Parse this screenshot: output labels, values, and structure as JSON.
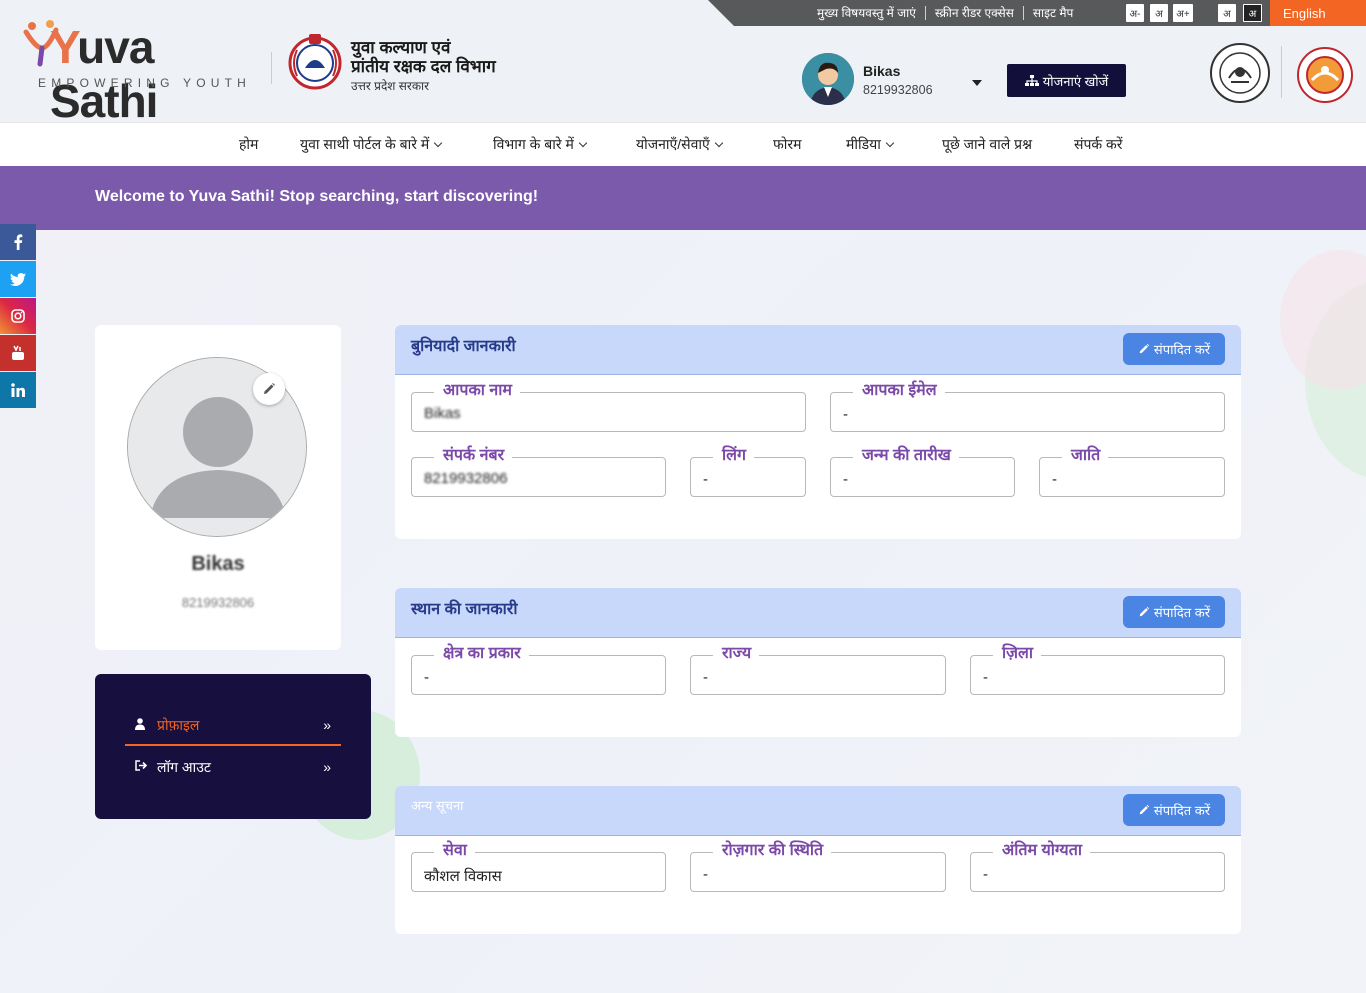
{
  "topbar": {
    "links": [
      "मुख्य विषयवस्तु में जाएं",
      "स्क्रीन रीडर एक्सेस",
      "साइट मैप"
    ],
    "font_sizes": [
      "अ-",
      "अ",
      "अ+"
    ],
    "contrast": [
      "अ",
      "अ"
    ],
    "language": "English"
  },
  "header": {
    "logo_word_first": "Y",
    "logo_word_rest": "uva Sathi",
    "logo_tagline": "EMPOWERING YOUTH",
    "dept_line1": "युवा कल्याण एवं",
    "dept_line2": "प्रांतीय रक्षक दल विभाग",
    "dept_line3": "उत्तर प्रदेश सरकार",
    "user_name": "Bikas",
    "user_phone": "8219932806",
    "search_schemes": "योजनाएं खोजें"
  },
  "nav": {
    "items": [
      {
        "label": "होम",
        "dropdown": false
      },
      {
        "label": "युवा साथी पोर्टल के बारे में",
        "dropdown": true
      },
      {
        "label": "विभाग के बारे में",
        "dropdown": true
      },
      {
        "label": "योजनाएँ/सेवाएँ",
        "dropdown": true
      },
      {
        "label": "फोरम",
        "dropdown": false
      },
      {
        "label": "मीडिया",
        "dropdown": true
      },
      {
        "label": "पूछे जाने वाले प्रश्न",
        "dropdown": false
      },
      {
        "label": "संपर्क करें",
        "dropdown": false
      }
    ]
  },
  "banner": {
    "text": "Welcome to Yuva Sathi! Stop searching, start discovering!"
  },
  "social": [
    "f",
    "t",
    "ig",
    "yt",
    "in"
  ],
  "profile_card": {
    "name": "Bikas",
    "phone": "8219932806"
  },
  "side_menu": {
    "items": [
      {
        "label": "प्रोफ़ाइल",
        "icon": "user-icon",
        "active": true
      },
      {
        "label": "लॉग आउट",
        "icon": "logout-icon",
        "active": false
      }
    ]
  },
  "basic_info": {
    "title": "बुनियादी जानकारी",
    "edit": "संपादित करें",
    "fields": [
      {
        "label": "आपका नाम",
        "value": "Bikas"
      },
      {
        "label": "आपका ईमेल",
        "value": "-"
      },
      {
        "label": "संपर्क नंबर",
        "value": "8219932806"
      },
      {
        "label": "लिंग",
        "value": "-"
      },
      {
        "label": "जन्म की तारीख",
        "value": "-"
      },
      {
        "label": "जाति",
        "value": "-"
      }
    ]
  },
  "location_info": {
    "title": "स्थान की जानकारी",
    "edit": "संपादित करें",
    "fields": [
      {
        "label": "क्षेत्र का प्रकार",
        "value": "-"
      },
      {
        "label": "राज्य",
        "value": "-"
      },
      {
        "label": "ज़िला",
        "value": "-"
      }
    ]
  },
  "other_info": {
    "title": "अन्य सूचना",
    "edit": "संपादित करें",
    "fields": [
      {
        "label": "सेवा",
        "value": "कौशल विकास"
      },
      {
        "label": "रोज़गार की स्थिति",
        "value": "-"
      },
      {
        "label": "अंतिम योग्यता",
        "value": "-"
      }
    ]
  },
  "colors": {
    "accent_orange": "#f26522",
    "banner_purple": "#7b59ab",
    "menu_dark": "#170f3d",
    "panel_head": "#c8d8fb",
    "edit_button": "#4a85e3",
    "field_label": "#7b4aa8"
  }
}
